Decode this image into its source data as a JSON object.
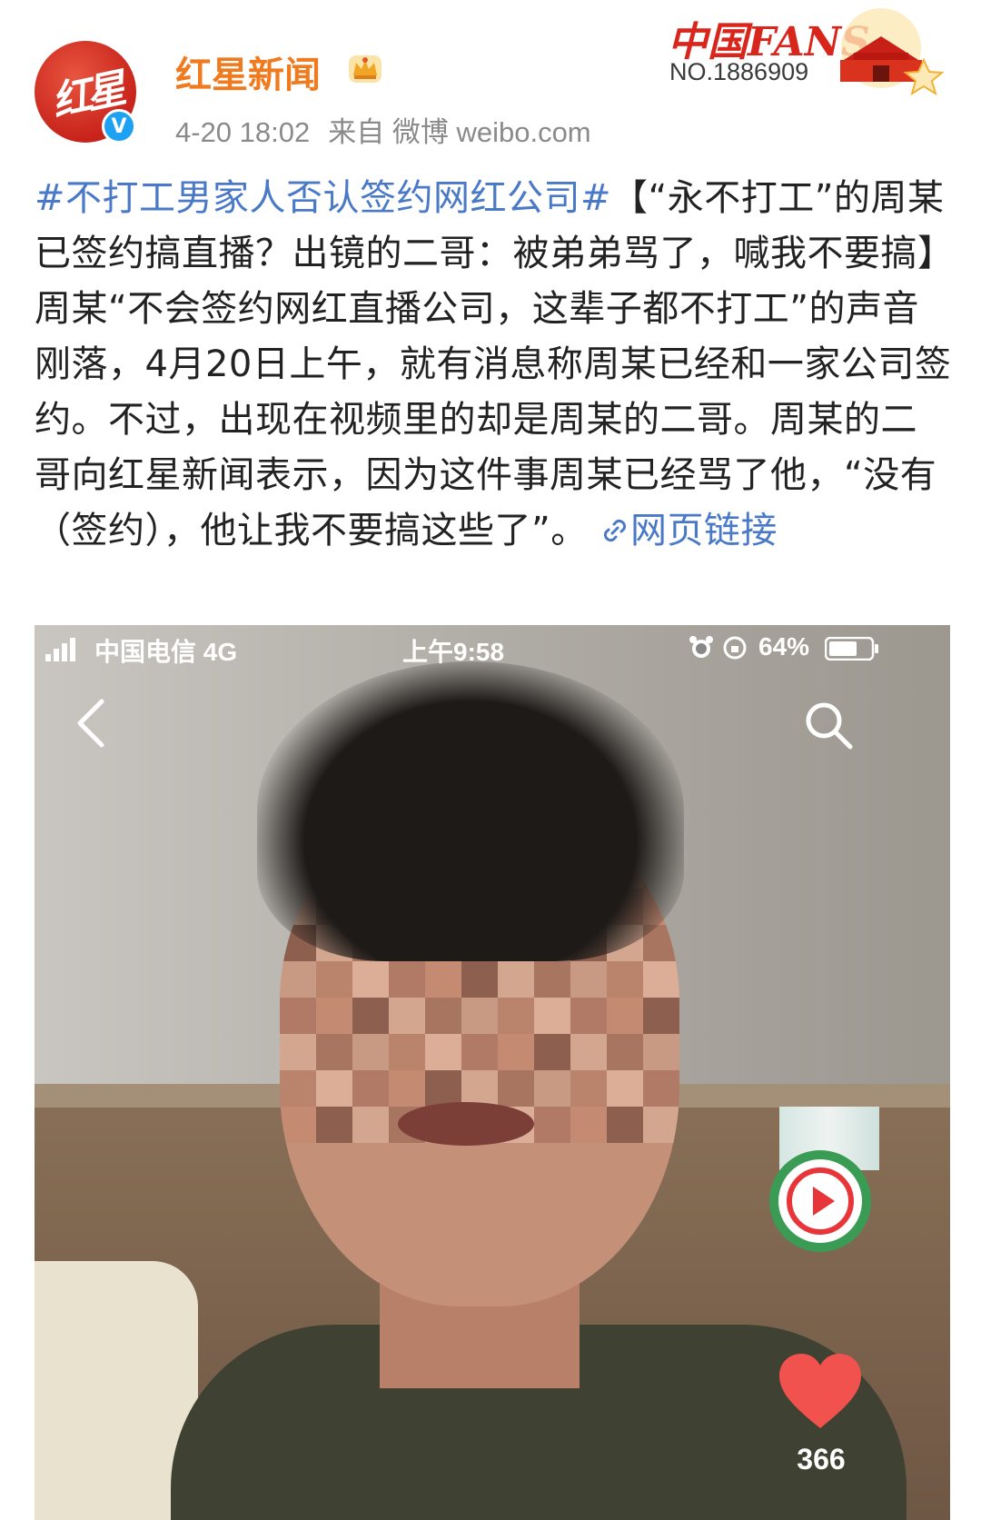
{
  "account": {
    "avatar_text": "红星",
    "verified_mark": "V",
    "name": "红星新闻",
    "time": "4-20 18:02",
    "source": "来自 微博 weibo.com"
  },
  "fans_badge": {
    "title": "中国FANS",
    "number": "NO.1886909"
  },
  "post": {
    "hashtag": "#不打工男家人否认签约网红公司#",
    "body": "【“永不打工”的周某已签约搞直播？出镜的二哥：被弟弟骂了，喊我不要搞】周某“不会签约网红直播公司，这辈子都不打工”的声音刚落，4月20日上午，就有消息称周某已经和一家公司签约。不过，出现在视频里的却是周某的二哥。周某的二哥向红星新闻表示，因为这件事周某已经骂了他，“没有（签约），他让我不要搞这些了”。",
    "link_label": "网页链接"
  },
  "video": {
    "carrier": "中国电信 4G",
    "clock": "上午9:58",
    "battery": "64%",
    "likes": "366"
  },
  "colors": {
    "username": "#f07a1e",
    "link": "#4a79c7",
    "text": "#222222",
    "meta": "#8a8a8a",
    "play_button": "#e8353a",
    "heart": "#f2524e"
  }
}
